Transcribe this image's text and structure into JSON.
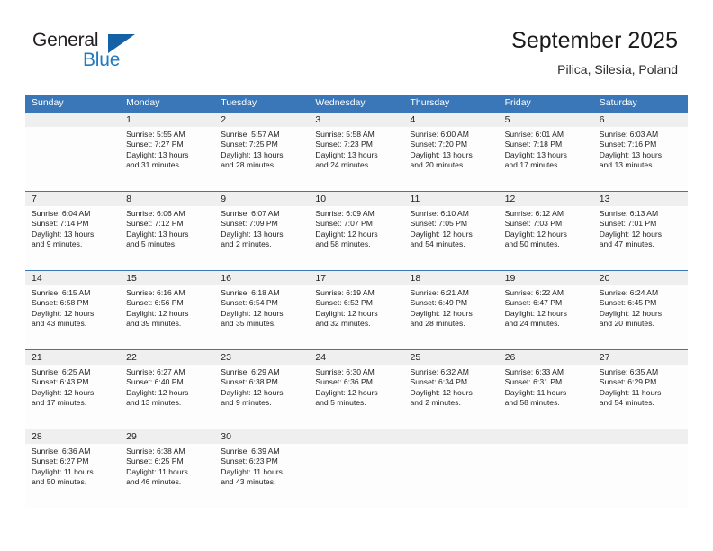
{
  "branding": {
    "name_part1": "General",
    "name_part2": "Blue",
    "triangle_color": "#1461a6",
    "blue_text_color": "#1f7bc1"
  },
  "header": {
    "title": "September 2025",
    "location": "Pilica, Silesia, Poland",
    "accent_color": "#3a77b8",
    "daynum_band_color": "#efefef"
  },
  "calendar": {
    "weekday_headers": [
      "Sunday",
      "Monday",
      "Tuesday",
      "Wednesday",
      "Thursday",
      "Friday",
      "Saturday"
    ],
    "weeks": [
      [
        {
          "day": "",
          "sunrise": "",
          "sunset": "",
          "daylight_line1": "",
          "daylight_line2": ""
        },
        {
          "day": "1",
          "sunrise": "Sunrise: 5:55 AM",
          "sunset": "Sunset: 7:27 PM",
          "daylight_line1": "Daylight: 13 hours",
          "daylight_line2": "and 31 minutes."
        },
        {
          "day": "2",
          "sunrise": "Sunrise: 5:57 AM",
          "sunset": "Sunset: 7:25 PM",
          "daylight_line1": "Daylight: 13 hours",
          "daylight_line2": "and 28 minutes."
        },
        {
          "day": "3",
          "sunrise": "Sunrise: 5:58 AM",
          "sunset": "Sunset: 7:23 PM",
          "daylight_line1": "Daylight: 13 hours",
          "daylight_line2": "and 24 minutes."
        },
        {
          "day": "4",
          "sunrise": "Sunrise: 6:00 AM",
          "sunset": "Sunset: 7:20 PM",
          "daylight_line1": "Daylight: 13 hours",
          "daylight_line2": "and 20 minutes."
        },
        {
          "day": "5",
          "sunrise": "Sunrise: 6:01 AM",
          "sunset": "Sunset: 7:18 PM",
          "daylight_line1": "Daylight: 13 hours",
          "daylight_line2": "and 17 minutes."
        },
        {
          "day": "6",
          "sunrise": "Sunrise: 6:03 AM",
          "sunset": "Sunset: 7:16 PM",
          "daylight_line1": "Daylight: 13 hours",
          "daylight_line2": "and 13 minutes."
        }
      ],
      [
        {
          "day": "7",
          "sunrise": "Sunrise: 6:04 AM",
          "sunset": "Sunset: 7:14 PM",
          "daylight_line1": "Daylight: 13 hours",
          "daylight_line2": "and 9 minutes."
        },
        {
          "day": "8",
          "sunrise": "Sunrise: 6:06 AM",
          "sunset": "Sunset: 7:12 PM",
          "daylight_line1": "Daylight: 13 hours",
          "daylight_line2": "and 5 minutes."
        },
        {
          "day": "9",
          "sunrise": "Sunrise: 6:07 AM",
          "sunset": "Sunset: 7:09 PM",
          "daylight_line1": "Daylight: 13 hours",
          "daylight_line2": "and 2 minutes."
        },
        {
          "day": "10",
          "sunrise": "Sunrise: 6:09 AM",
          "sunset": "Sunset: 7:07 PM",
          "daylight_line1": "Daylight: 12 hours",
          "daylight_line2": "and 58 minutes."
        },
        {
          "day": "11",
          "sunrise": "Sunrise: 6:10 AM",
          "sunset": "Sunset: 7:05 PM",
          "daylight_line1": "Daylight: 12 hours",
          "daylight_line2": "and 54 minutes."
        },
        {
          "day": "12",
          "sunrise": "Sunrise: 6:12 AM",
          "sunset": "Sunset: 7:03 PM",
          "daylight_line1": "Daylight: 12 hours",
          "daylight_line2": "and 50 minutes."
        },
        {
          "day": "13",
          "sunrise": "Sunrise: 6:13 AM",
          "sunset": "Sunset: 7:01 PM",
          "daylight_line1": "Daylight: 12 hours",
          "daylight_line2": "and 47 minutes."
        }
      ],
      [
        {
          "day": "14",
          "sunrise": "Sunrise: 6:15 AM",
          "sunset": "Sunset: 6:58 PM",
          "daylight_line1": "Daylight: 12 hours",
          "daylight_line2": "and 43 minutes."
        },
        {
          "day": "15",
          "sunrise": "Sunrise: 6:16 AM",
          "sunset": "Sunset: 6:56 PM",
          "daylight_line1": "Daylight: 12 hours",
          "daylight_line2": "and 39 minutes."
        },
        {
          "day": "16",
          "sunrise": "Sunrise: 6:18 AM",
          "sunset": "Sunset: 6:54 PM",
          "daylight_line1": "Daylight: 12 hours",
          "daylight_line2": "and 35 minutes."
        },
        {
          "day": "17",
          "sunrise": "Sunrise: 6:19 AM",
          "sunset": "Sunset: 6:52 PM",
          "daylight_line1": "Daylight: 12 hours",
          "daylight_line2": "and 32 minutes."
        },
        {
          "day": "18",
          "sunrise": "Sunrise: 6:21 AM",
          "sunset": "Sunset: 6:49 PM",
          "daylight_line1": "Daylight: 12 hours",
          "daylight_line2": "and 28 minutes."
        },
        {
          "day": "19",
          "sunrise": "Sunrise: 6:22 AM",
          "sunset": "Sunset: 6:47 PM",
          "daylight_line1": "Daylight: 12 hours",
          "daylight_line2": "and 24 minutes."
        },
        {
          "day": "20",
          "sunrise": "Sunrise: 6:24 AM",
          "sunset": "Sunset: 6:45 PM",
          "daylight_line1": "Daylight: 12 hours",
          "daylight_line2": "and 20 minutes."
        }
      ],
      [
        {
          "day": "21",
          "sunrise": "Sunrise: 6:25 AM",
          "sunset": "Sunset: 6:43 PM",
          "daylight_line1": "Daylight: 12 hours",
          "daylight_line2": "and 17 minutes."
        },
        {
          "day": "22",
          "sunrise": "Sunrise: 6:27 AM",
          "sunset": "Sunset: 6:40 PM",
          "daylight_line1": "Daylight: 12 hours",
          "daylight_line2": "and 13 minutes."
        },
        {
          "day": "23",
          "sunrise": "Sunrise: 6:29 AM",
          "sunset": "Sunset: 6:38 PM",
          "daylight_line1": "Daylight: 12 hours",
          "daylight_line2": "and 9 minutes."
        },
        {
          "day": "24",
          "sunrise": "Sunrise: 6:30 AM",
          "sunset": "Sunset: 6:36 PM",
          "daylight_line1": "Daylight: 12 hours",
          "daylight_line2": "and 5 minutes."
        },
        {
          "day": "25",
          "sunrise": "Sunrise: 6:32 AM",
          "sunset": "Sunset: 6:34 PM",
          "daylight_line1": "Daylight: 12 hours",
          "daylight_line2": "and 2 minutes."
        },
        {
          "day": "26",
          "sunrise": "Sunrise: 6:33 AM",
          "sunset": "Sunset: 6:31 PM",
          "daylight_line1": "Daylight: 11 hours",
          "daylight_line2": "and 58 minutes."
        },
        {
          "day": "27",
          "sunrise": "Sunrise: 6:35 AM",
          "sunset": "Sunset: 6:29 PM",
          "daylight_line1": "Daylight: 11 hours",
          "daylight_line2": "and 54 minutes."
        }
      ],
      [
        {
          "day": "28",
          "sunrise": "Sunrise: 6:36 AM",
          "sunset": "Sunset: 6:27 PM",
          "daylight_line1": "Daylight: 11 hours",
          "daylight_line2": "and 50 minutes."
        },
        {
          "day": "29",
          "sunrise": "Sunrise: 6:38 AM",
          "sunset": "Sunset: 6:25 PM",
          "daylight_line1": "Daylight: 11 hours",
          "daylight_line2": "and 46 minutes."
        },
        {
          "day": "30",
          "sunrise": "Sunrise: 6:39 AM",
          "sunset": "Sunset: 6:23 PM",
          "daylight_line1": "Daylight: 11 hours",
          "daylight_line2": "and 43 minutes."
        },
        {
          "day": "",
          "sunrise": "",
          "sunset": "",
          "daylight_line1": "",
          "daylight_line2": ""
        },
        {
          "day": "",
          "sunrise": "",
          "sunset": "",
          "daylight_line1": "",
          "daylight_line2": ""
        },
        {
          "day": "",
          "sunrise": "",
          "sunset": "",
          "daylight_line1": "",
          "daylight_line2": ""
        },
        {
          "day": "",
          "sunrise": "",
          "sunset": "",
          "daylight_line1": "",
          "daylight_line2": ""
        }
      ]
    ]
  }
}
